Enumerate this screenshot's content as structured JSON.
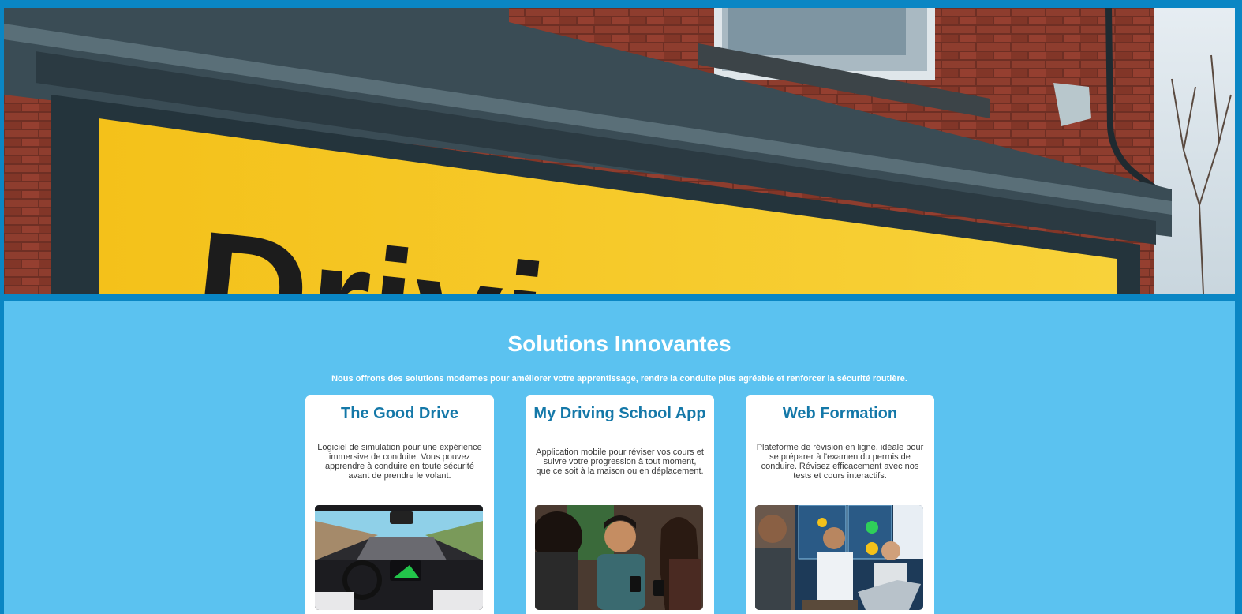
{
  "hero": {
    "sign_text": "Driving Sc",
    "image_alt": "Driving school storefront sign"
  },
  "section": {
    "title": "Solutions Innovantes",
    "subtitle": "Nous offrons des solutions modernes pour améliorer votre apprentissage, rendre la conduite plus agréable et renforcer la sécurité routière."
  },
  "cards": [
    {
      "title": "The Good Drive",
      "description": "Logiciel de simulation pour une expérience immersive de conduite. Vous pouvez apprendre à conduire en toute sécurité avant de prendre le volant."
    },
    {
      "title": "My Driving School App",
      "description": "Application mobile pour réviser vos cours et suivre votre progression à tout moment, que ce soit à la maison ou en déplacement."
    },
    {
      "title": "Web Formation",
      "description": "Plateforme de révision en ligne, idéale pour se préparer à l'examen du permis de conduire. Révisez efficacement avec nos tests et cours interactifs."
    }
  ],
  "colors": {
    "frame": "#0a86c4",
    "section_bg": "#5bc2f0",
    "card_title": "#1478a8",
    "sign_yellow": "#f6c51c"
  }
}
